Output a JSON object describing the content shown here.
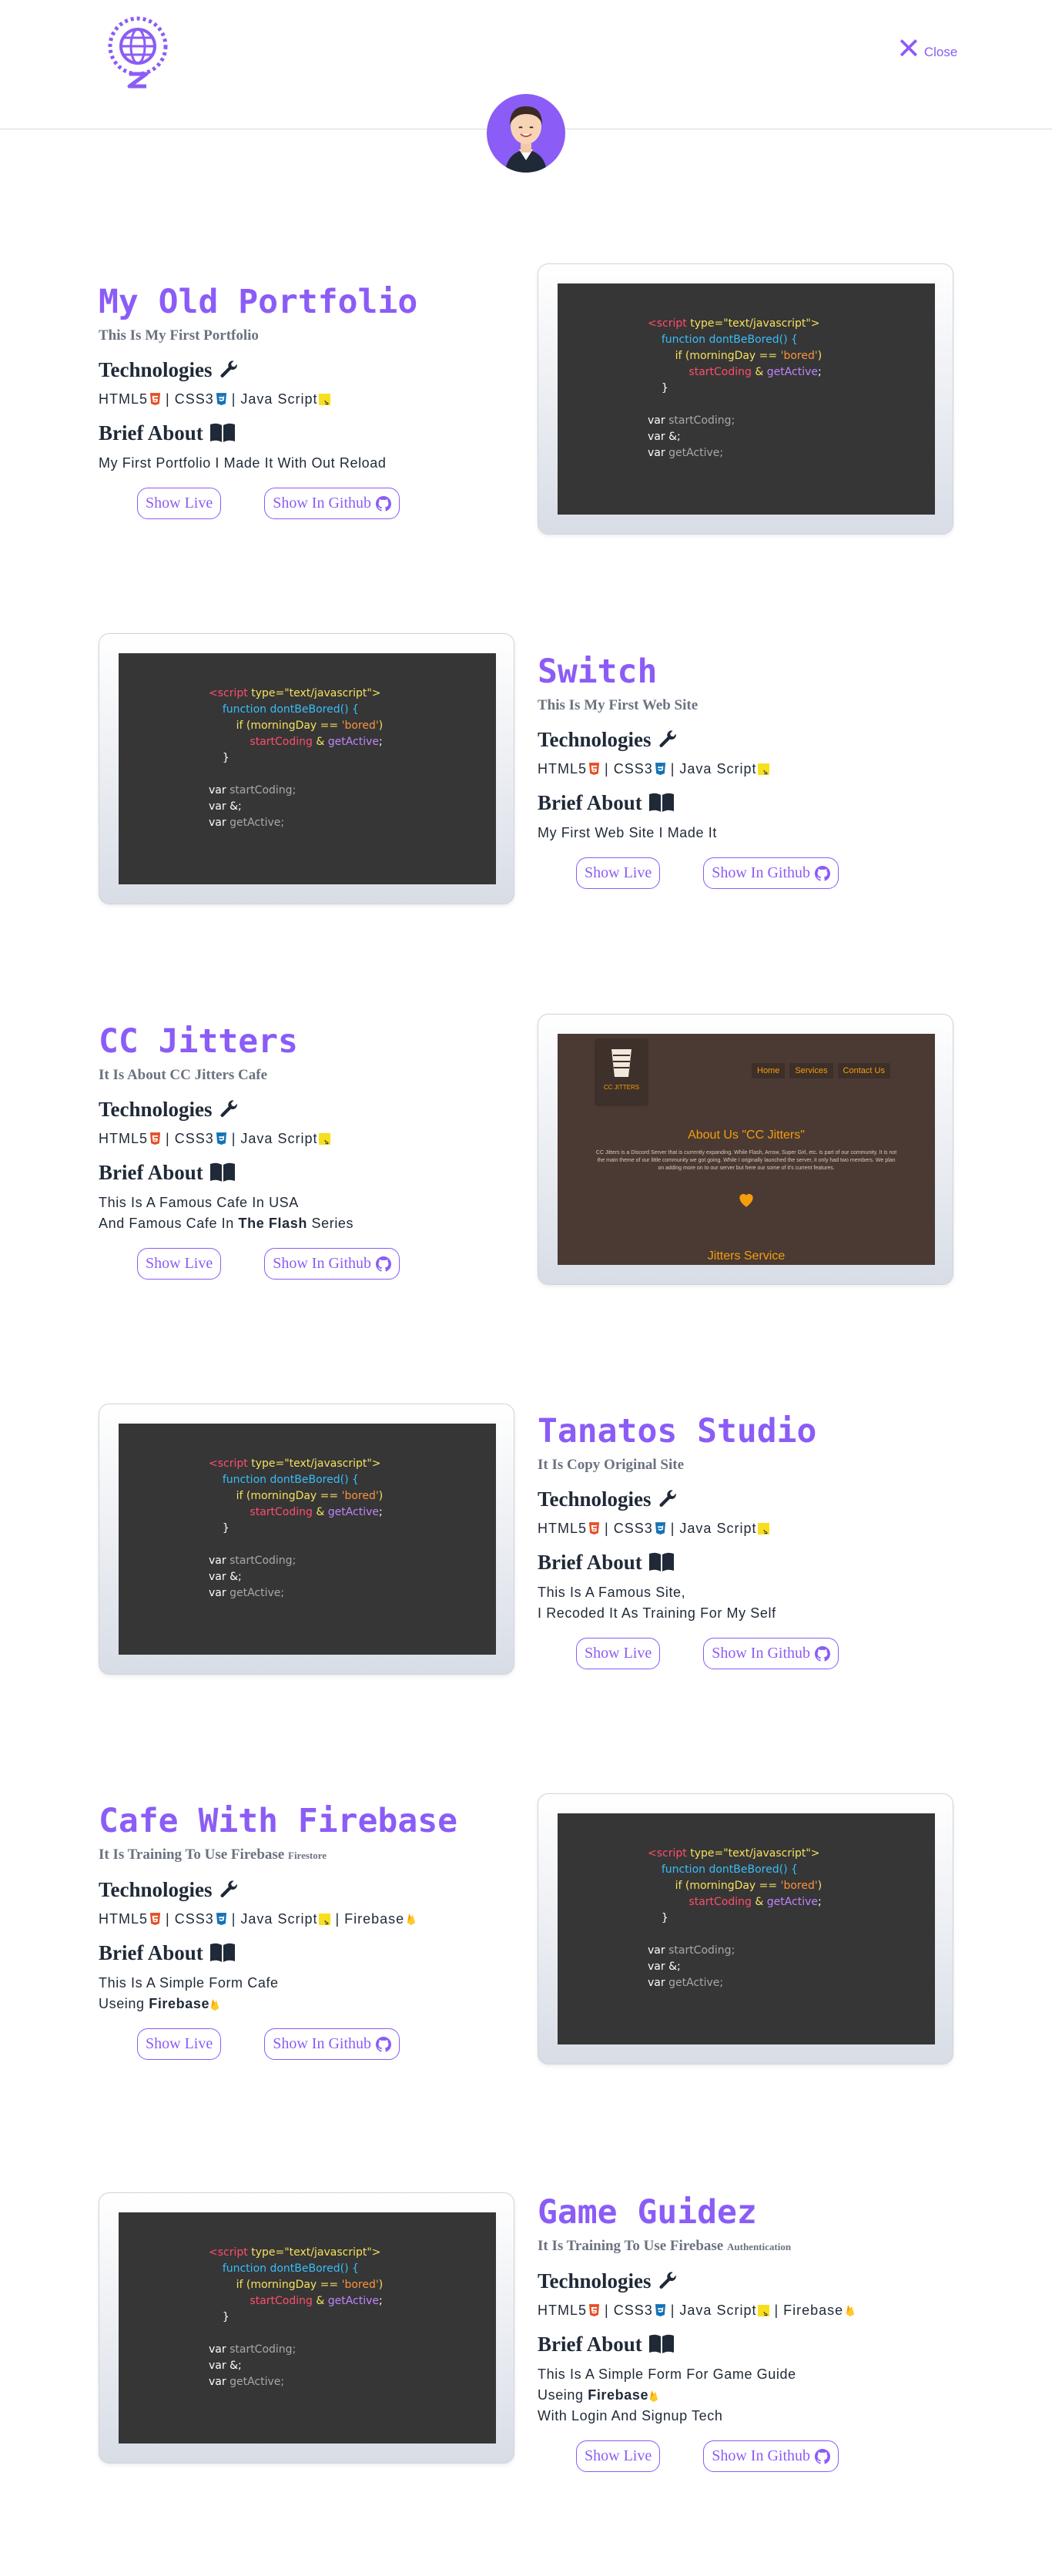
{
  "header": {
    "close_label": "Close",
    "logo_icon": "globe-z-logo-icon",
    "avatar_icon": "developer-avatar-icon",
    "accent": "#8b5cf6"
  },
  "labels": {
    "technologies": "Technologies",
    "brief_about": "Brief About",
    "show_live": "Show Live",
    "show_github": "Show In Github"
  },
  "tech": {
    "html": "HTML5",
    "css": "CSS3",
    "js": "Java Script",
    "firebase": "Firebase",
    "sep": "|"
  },
  "code_sample": {
    "l1_tag": "<script",
    "l1_attr": " type=\"text/javascript\">",
    "l2": "function dontBeBored() {",
    "l3_a": "if (morningDay == ",
    "l3_b": "'bored'",
    "l3_c": ")",
    "l4_a": "startCoding",
    "l4_b": " & ",
    "l4_c": "getActive",
    "l4_d": ";",
    "l5": "}",
    "l6_a": "var ",
    "l6_b": "startCoding;",
    "l7": "var &;",
    "l8_a": "var ",
    "l8_b": "getActive;"
  },
  "jitters_preview": {
    "nav": [
      "Home",
      "Services",
      "Contact Us"
    ],
    "about_title": "About Us \"CC Jitters\"",
    "about_text": "CC Jitters is a Discord Server that is currently expanding. While Flash, Arrow, Super Girl, etc. is part of our community. It is not the main theme of our little community we got going. While I originally launched the server, it only had two members. We plan on adding more on to our server but here our some of it's current features.",
    "service_title": "Jitters Service",
    "logo_text": "CC JITTERS"
  },
  "projects": [
    {
      "title": "My Old Portfolio",
      "subtitle": "This Is My First Portfolio",
      "subtitle_small": "",
      "desc1": "My First Portfolio I Made It With Out Reload",
      "desc2": "",
      "desc3": ""
    },
    {
      "title": "Switch",
      "subtitle": "This Is My First Web Site",
      "subtitle_small": "",
      "desc1": "My First Web Site I Made It",
      "desc2": "",
      "desc3": ""
    },
    {
      "title": "CC Jitters",
      "subtitle": "It Is About CC Jitters Cafe",
      "subtitle_small": "",
      "desc1": "This Is A Famous Cafe In USA",
      "desc2_a": "And Famous Cafe In ",
      "desc2_b": "The Flash",
      "desc2_c": " Series"
    },
    {
      "title": "Tanatos Studio",
      "subtitle": "It Is Copy Original Site",
      "subtitle_small": "",
      "desc1": "This Is A Famous Site,",
      "desc2": "I Recoded It As Training For My Self",
      "desc3": ""
    },
    {
      "title": "Cafe With Firebase",
      "subtitle": "It Is Training To Use Firebase",
      "subtitle_small": "Firestore",
      "desc1": "This Is A Simple Form Cafe",
      "desc2_a": "Useing ",
      "desc2_b": "Firebase"
    },
    {
      "title": "Game Guidez",
      "subtitle": "It Is Training To Use Firebase",
      "subtitle_small": "Authentication",
      "desc1": "This Is A Simple Form For Game Guide",
      "desc2_a": "Useing ",
      "desc2_b": "Firebase",
      "desc3": "With Login And Signup Tech"
    }
  ]
}
